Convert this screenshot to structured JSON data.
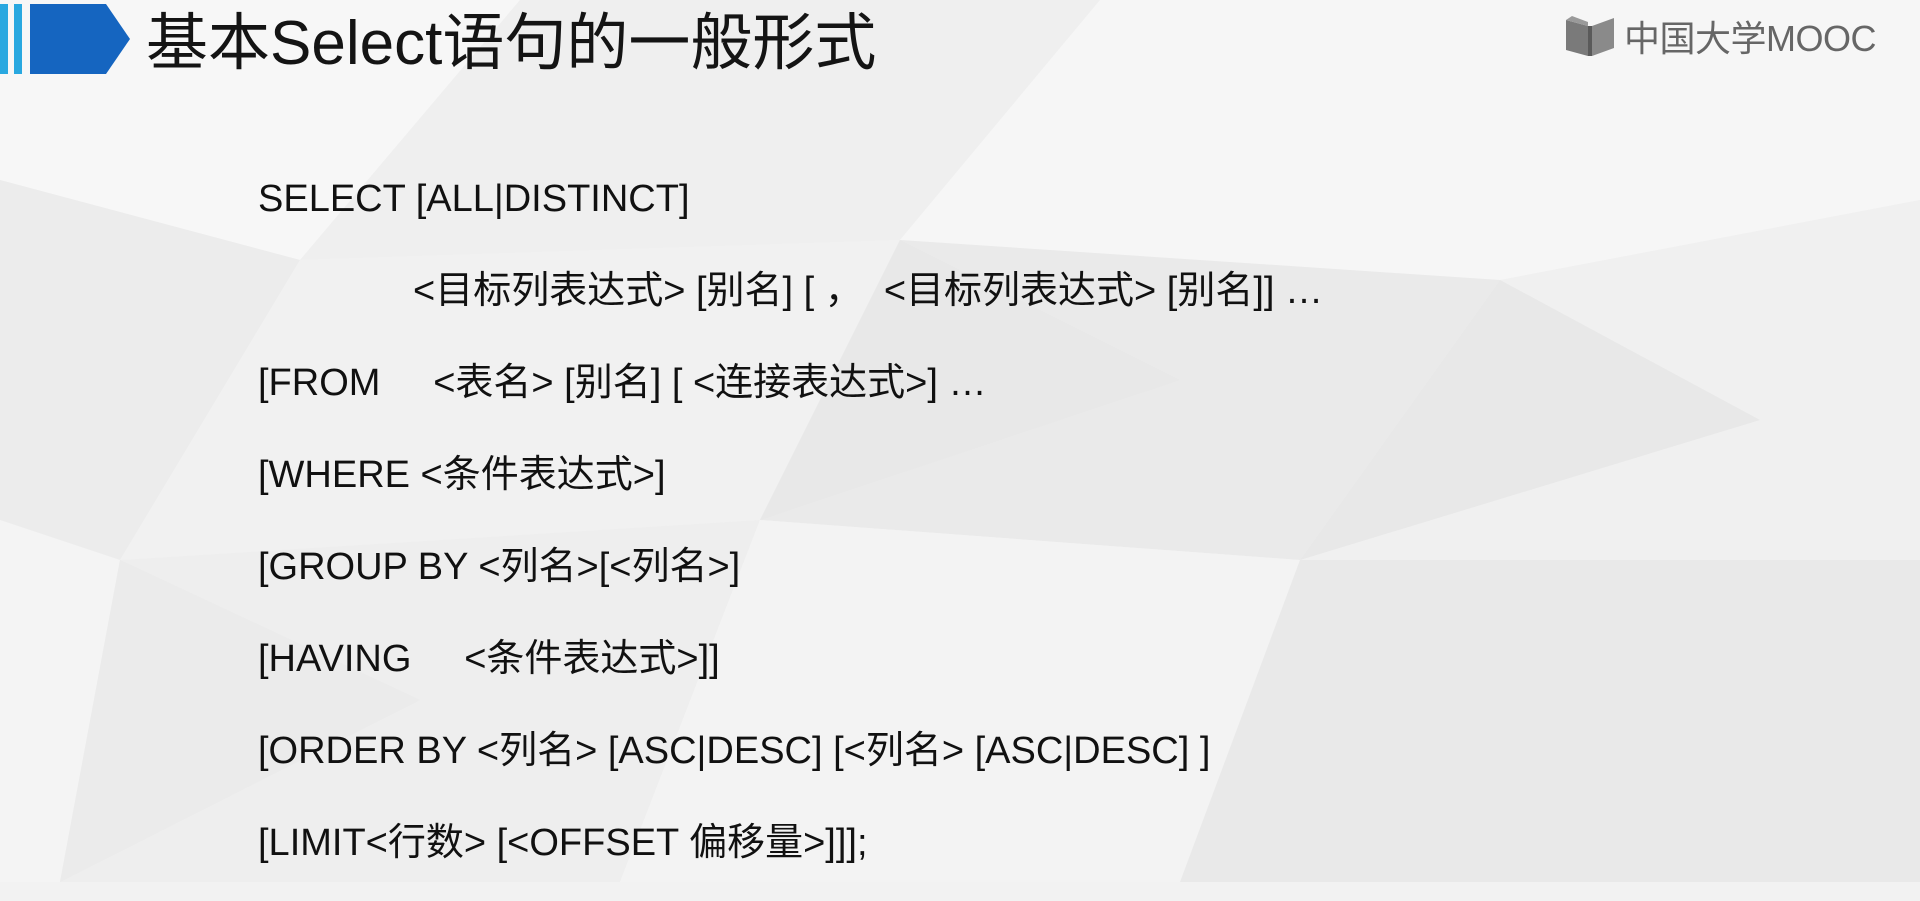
{
  "slide": {
    "title": "基本Select语句的一般形式",
    "logo_text": "中国大学MOOC",
    "logo_icon": "open-book-icon",
    "accent_color": "#1565c0",
    "accent_light_color": "#29a8e0"
  },
  "code_lines": [
    "SELECT [ALL|DISTINCT]",
    "<目标列表达式> [别名] [ ，  <目标列表达式> [别名]] …",
    "[FROM     <表名> [别名] [ <连接表达式>] …",
    "[WHERE <条件表达式>]",
    "[GROUP BY <列名>[<列名>]",
    "[HAVING     <条件表达式>]]",
    "[ORDER BY <列名> [ASC|DESC] [<列名> [ASC|DESC] ]",
    "[LIMIT<行数> [<OFFSET 偏移量>]]];"
  ]
}
